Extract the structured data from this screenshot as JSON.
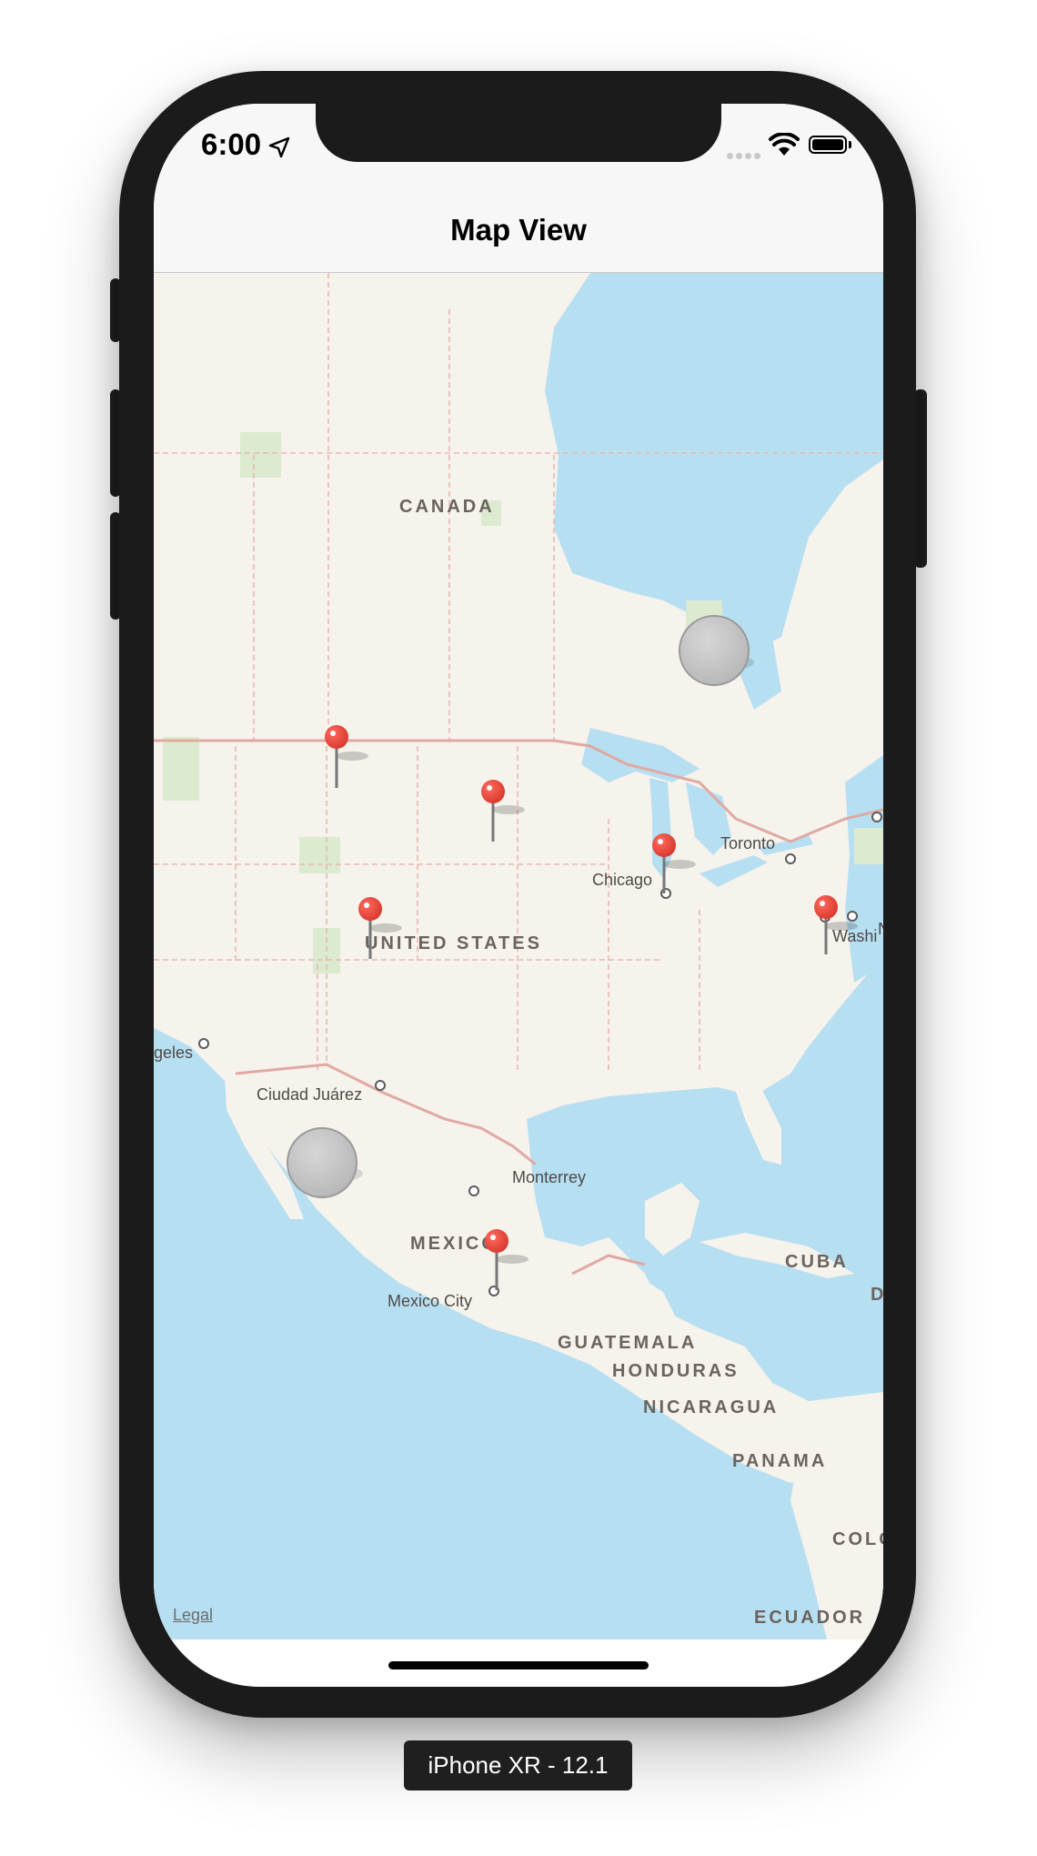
{
  "status_bar": {
    "time": "6:00",
    "location_icon": "location-arrow-icon",
    "signal_icon": "cellular-signal-icon",
    "wifi_icon": "wifi-icon",
    "battery_icon": "battery-icon"
  },
  "nav": {
    "title": "Map View"
  },
  "map": {
    "countries": {
      "canada": "CANADA",
      "united_states": "UNITED STATES",
      "mexico": "MEXICO",
      "cuba": "CUBA",
      "guatemala": "GUATEMALA",
      "honduras": "HONDURAS",
      "nicaragua": "NICARAGUA",
      "panama": "PANAMA",
      "colombia_partial": "COLO",
      "ecuador": "ECUADOR",
      "dominican_partial": "D"
    },
    "cities": {
      "toronto": "Toronto",
      "chicago": "Chicago",
      "washington_partial": "Washi",
      "los_angeles_partial": "geles",
      "ciudad_juarez": "Ciudad Juárez",
      "monterrey": "Monterrey",
      "mexico_city": "Mexico City",
      "new_york_partial": "N"
    },
    "legal": "Legal",
    "pin_color": "#e8473a",
    "water_color": "#b7dff2",
    "land_color": "#f6f2ec"
  },
  "device_label": "iPhone XR - 12.1"
}
